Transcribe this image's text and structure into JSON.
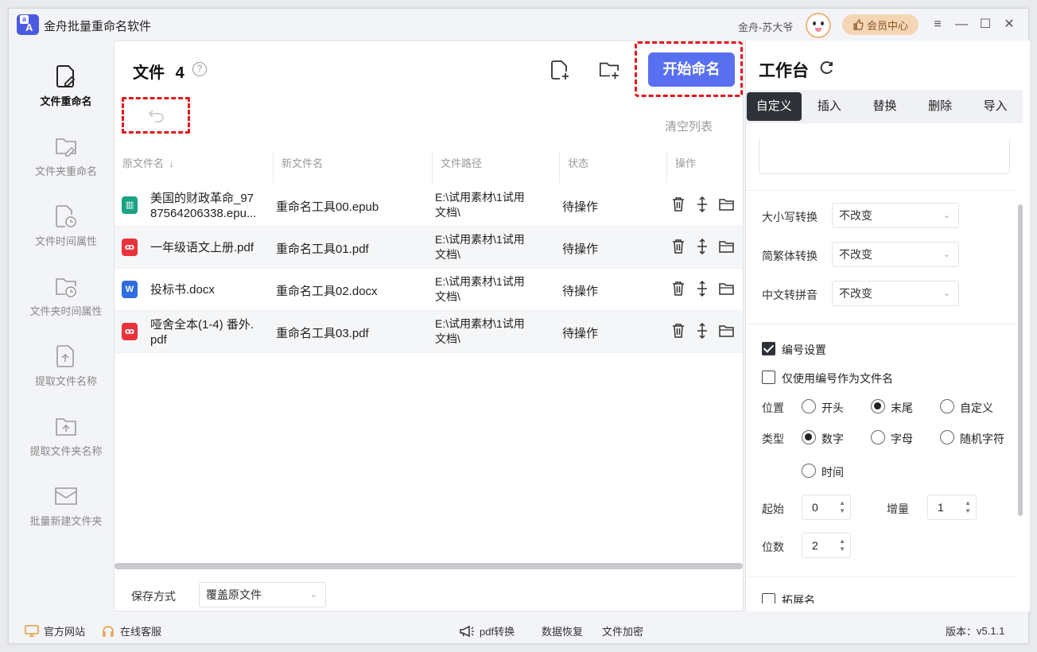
{
  "app": {
    "title": "金舟批量重命名软件",
    "user": "金舟-苏大爷",
    "vip_label": "会员中心"
  },
  "sidebar": {
    "items": [
      {
        "label": "文件重命名"
      },
      {
        "label": "文件夹重命名"
      },
      {
        "label": "文件时间属性"
      },
      {
        "label": "文件夹时间属性"
      },
      {
        "label": "提取文件名称"
      },
      {
        "label": "提取文件夹名称"
      },
      {
        "label": "批量新建文件夹"
      }
    ],
    "active_index": 0
  },
  "main": {
    "title": "文件",
    "count": "4",
    "start_label": "开始命名",
    "clear_label": "清空列表",
    "columns": [
      "原文件名",
      "新文件名",
      "文件路径",
      "状态",
      "操作"
    ],
    "rows": [
      {
        "type": "epub",
        "original": "美国的财政革命_9787564206338.epu...",
        "original_line1": "美国的财政革命_97",
        "original_line2": "87564206338.epu...",
        "new": "重命名工具00.epub",
        "path": "E:\\试用素材\\1试用文档\\",
        "path_line1": "E:\\试用素材\\1试用",
        "path_line2": "文档\\",
        "state": "待操作"
      },
      {
        "type": "pdf",
        "original": "一年级语文上册.pdf",
        "new": "重命名工具01.pdf",
        "path": "E:\\试用素材\\1试用文档\\",
        "path_line1": "E:\\试用素材\\1试用",
        "path_line2": "文档\\",
        "state": "待操作"
      },
      {
        "type": "docx",
        "original": "投标书.docx",
        "new": "重命名工具02.docx",
        "path": "E:\\试用素材\\1试用文档\\",
        "path_line1": "E:\\试用素材\\1试用",
        "path_line2": "文档\\",
        "state": "待操作"
      },
      {
        "type": "pdf",
        "original": "哑舍全本(1-4) 番外.pdf",
        "original_line1": "哑舍全本(1-4) 番外.",
        "original_line2": "pdf",
        "new": "重命名工具03.pdf",
        "path": "E:\\试用素材\\1试用文档\\",
        "path_line1": "E:\\试用素材\\1试用",
        "path_line2": "文档\\",
        "state": "待操作"
      }
    ],
    "save_mode_label": "保存方式",
    "save_mode_value": "覆盖原文件"
  },
  "workbench": {
    "title": "工作台",
    "tabs": [
      "自定义",
      "插入",
      "替换",
      "删除",
      "导入"
    ],
    "active_tab": 0,
    "case_label": "大小写转换",
    "case_value": "不改变",
    "trad_label": "简繁体转换",
    "trad_value": "不改变",
    "pinyin_label": "中文转拼音",
    "pinyin_value": "不改变",
    "numbering_label": "编号设置",
    "numbering_checked": true,
    "only_number_label": "仅使用编号作为文件名",
    "only_number_checked": false,
    "position_label": "位置",
    "position_options": [
      "开头",
      "末尾",
      "自定义"
    ],
    "position_selected": 1,
    "type_label": "类型",
    "type_options": [
      "数字",
      "字母",
      "随机字符",
      "时间"
    ],
    "type_selected": 0,
    "start_label": "起始",
    "start_value": "0",
    "step_label": "增量",
    "step_value": "1",
    "digits_label": "位数",
    "digits_value": "2",
    "ext_label": "拓展名"
  },
  "footer": {
    "website": "官方网站",
    "service": "在线客服",
    "pdf": "pdf转换",
    "recovery": "数据恢复",
    "encrypt": "文件加密",
    "version_label": "版本：",
    "version": "v5.1.1"
  },
  "colors": {
    "accent": "#5870f0",
    "highlight": "#e3181c",
    "active_tab": "#2e3137",
    "pdf": "#e8333b",
    "docx": "#2f6de1",
    "epub": "#1aa383"
  }
}
